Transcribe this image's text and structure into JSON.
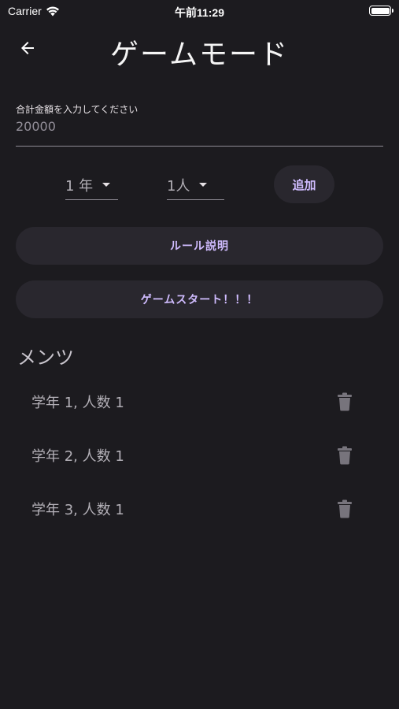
{
  "status_bar": {
    "carrier": "Carrier",
    "time": "午前11:29"
  },
  "app_bar": {
    "title": "ゲームモード",
    "back_icon": "arrow-left-icon"
  },
  "amount_field": {
    "label": "合計金額を入力してください",
    "value": "20000"
  },
  "selectors": {
    "year_value": "1 年",
    "people_value": "1人",
    "add_label": "追加"
  },
  "buttons": {
    "rules_label": "ルール説明",
    "start_label": "ゲームスタート！！！"
  },
  "members": {
    "title": "メンツ",
    "items": [
      {
        "label": "学年 1, 人数 1"
      },
      {
        "label": "学年 2, 人数 1"
      },
      {
        "label": "学年 3, 人数 1"
      }
    ],
    "delete_icon": "trash-icon"
  },
  "colors": {
    "background": "#1c1b1f",
    "button_bg": "#29272e",
    "accent": "#d0bcff"
  }
}
